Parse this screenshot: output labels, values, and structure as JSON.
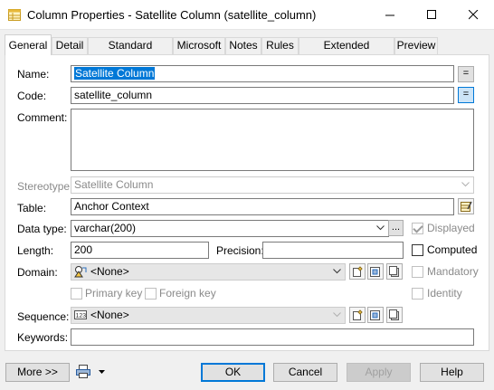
{
  "window": {
    "title": "Column Properties - Satellite Column (satellite_column)",
    "app_icon": "properties-table-icon",
    "controls": [
      "minimize-icon",
      "maximize-icon",
      "close-icon"
    ]
  },
  "tabs": [
    {
      "label": "General",
      "active": true
    },
    {
      "label": "Detail"
    },
    {
      "label": "Standard Checks"
    },
    {
      "label": "Microsoft"
    },
    {
      "label": "Notes"
    },
    {
      "label": "Rules"
    },
    {
      "label": "Extended Attributes"
    },
    {
      "label": "Preview"
    }
  ],
  "form": {
    "name_label": "Name:",
    "name_value": "Satellite Column",
    "code_label": "Code:",
    "code_value": "satellite_column",
    "equals_label": "=",
    "comment_label": "Comment:",
    "comment_value": "",
    "stereotype_label": "Stereotype:",
    "stereotype_value": "Satellite Column",
    "table_label": "Table:",
    "table_value": "Anchor Context",
    "datatype_label": "Data type:",
    "datatype_value": "varchar(200)",
    "ellipsis_label": "...",
    "displayed_label": "Displayed",
    "displayed_checked": true,
    "length_label": "Length:",
    "length_value": "200",
    "precision_label": "Precision:",
    "precision_value": "",
    "computed_label": "Computed",
    "domain_label": "Domain:",
    "domain_value": "<None>",
    "mandatory_label": "Mandatory",
    "primary_key_label": "Primary key",
    "foreign_key_label": "Foreign key",
    "identity_label": "Identity",
    "sequence_label": "Sequence:",
    "sequence_value": "<None>",
    "keywords_label": "Keywords:",
    "keywords_value": ""
  },
  "footer": {
    "more_label": "More >>",
    "ok_label": "OK",
    "cancel_label": "Cancel",
    "apply_label": "Apply",
    "help_label": "Help"
  },
  "colors": {
    "selection": "#0078d7",
    "window_bg": "#f0f0f0",
    "panel_bg": "#ffffff"
  }
}
